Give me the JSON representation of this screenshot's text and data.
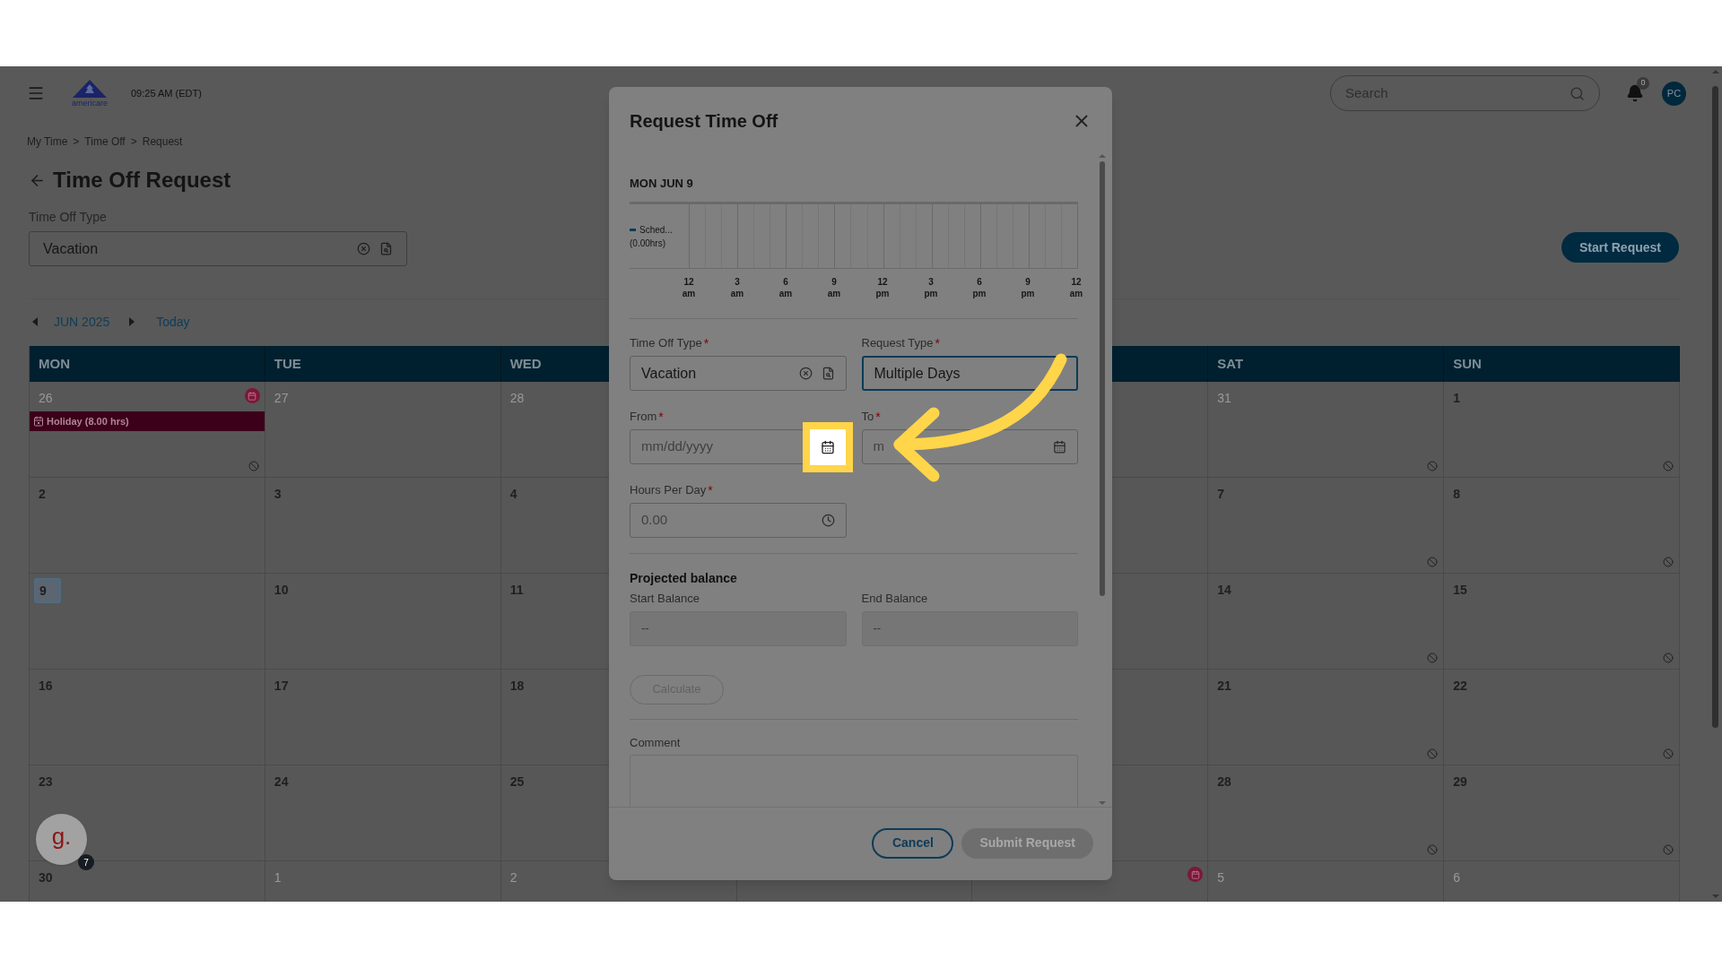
{
  "header": {
    "logo_text": "americare",
    "time": "09:25 AM (EDT)",
    "search": {
      "placeholder": "Search"
    },
    "notifications": "0",
    "avatar": "PC"
  },
  "breadcrumb": {
    "separator": ">",
    "items": [
      "My Time",
      "Time Off",
      "Request"
    ]
  },
  "page": {
    "title": "Time Off Request",
    "type_field": {
      "label": "Time Off Type",
      "value": "Vacation"
    },
    "start_button": "Start Request"
  },
  "calendar": {
    "month": "JUN 2025",
    "today_link": "Today",
    "left_columns": [
      "MON",
      "TUE",
      "WED"
    ],
    "right_columns": [
      "SAT",
      "SUN"
    ],
    "weeks": [
      {
        "left": [
          {
            "number": "26",
            "muted": true,
            "holiday_icon": true,
            "event": "Holiday (8.00 hrs)",
            "blocked": true
          },
          {
            "number": "27",
            "muted": true
          },
          {
            "number": "28",
            "muted": true
          }
        ],
        "right": [
          {
            "number": "31",
            "muted": true,
            "blocked": true
          },
          {
            "number": "1",
            "blocked": true
          }
        ]
      },
      {
        "left": [
          {
            "number": "2"
          },
          {
            "number": "3"
          },
          {
            "number": "4"
          }
        ],
        "right": [
          {
            "number": "7",
            "blocked": true
          },
          {
            "number": "8",
            "blocked": true
          }
        ]
      },
      {
        "left": [
          {
            "number": "9",
            "today": true
          },
          {
            "number": "10"
          },
          {
            "number": "11"
          }
        ],
        "right": [
          {
            "number": "14",
            "blocked": true
          },
          {
            "number": "15",
            "blocked": true
          }
        ]
      },
      {
        "left": [
          {
            "number": "16"
          },
          {
            "number": "17"
          },
          {
            "number": "18"
          }
        ],
        "right": [
          {
            "number": "21",
            "blocked": true
          },
          {
            "number": "22",
            "blocked": true
          }
        ]
      },
      {
        "left": [
          {
            "number": "23"
          },
          {
            "number": "24"
          },
          {
            "number": "25"
          }
        ],
        "right": [
          {
            "number": "28",
            "blocked": true
          },
          {
            "number": "29",
            "blocked": true
          }
        ]
      },
      {
        "left": [
          {
            "number": "30"
          },
          {
            "number": "1",
            "muted": true
          },
          {
            "number": "2",
            "muted": true
          }
        ],
        "friday": {
          "holiday_icon": true
        },
        "right": [
          {
            "number": "5",
            "muted": true
          },
          {
            "number": "6",
            "muted": true
          }
        ]
      }
    ]
  },
  "assistant": {
    "logo": "g.",
    "badge": "7"
  },
  "dialog": {
    "title": "Request Time Off",
    "day": "MON JUN 9",
    "required_symbol": "*",
    "legend": {
      "label": "Sched...",
      "hours": "(0.00hrs)"
    },
    "ticks": [
      {
        "hour": "12",
        "period": "am"
      },
      {
        "hour": "3",
        "period": "am"
      },
      {
        "hour": "6",
        "period": "am"
      },
      {
        "hour": "9",
        "period": "am"
      },
      {
        "hour": "12",
        "period": "pm"
      },
      {
        "hour": "3",
        "period": "pm"
      },
      {
        "hour": "6",
        "period": "pm"
      },
      {
        "hour": "9",
        "period": "pm"
      },
      {
        "hour": "12",
        "period": "am"
      }
    ],
    "fields": [
      {
        "kind": "lookup",
        "label": "Time Off Type",
        "required": true,
        "value": "Vacation"
      },
      {
        "kind": "select",
        "label": "Request Type",
        "required": true,
        "value": "Multiple Days",
        "focused": true
      },
      {
        "kind": "date",
        "label": "From",
        "required": true,
        "placeholder": "mm/dd/yyyy",
        "highlighted": true
      },
      {
        "kind": "date",
        "label": "To",
        "required": true,
        "placeholder": "m"
      },
      {
        "kind": "time",
        "label": "Hours Per Day",
        "required": true,
        "placeholder": "0.00"
      }
    ],
    "balance": {
      "title": "Projected balance",
      "fields": [
        {
          "label": "Start Balance",
          "value": "--"
        },
        {
          "label": "End Balance",
          "value": "--"
        }
      ]
    },
    "calculate": {
      "label": "Calculate",
      "disabled": true
    },
    "comment": {
      "label": "Comment"
    },
    "buttons": [
      {
        "kind": "secondary",
        "label": "Cancel"
      },
      {
        "kind": "primary",
        "label": "Submit Request",
        "disabled": true
      }
    ]
  }
}
